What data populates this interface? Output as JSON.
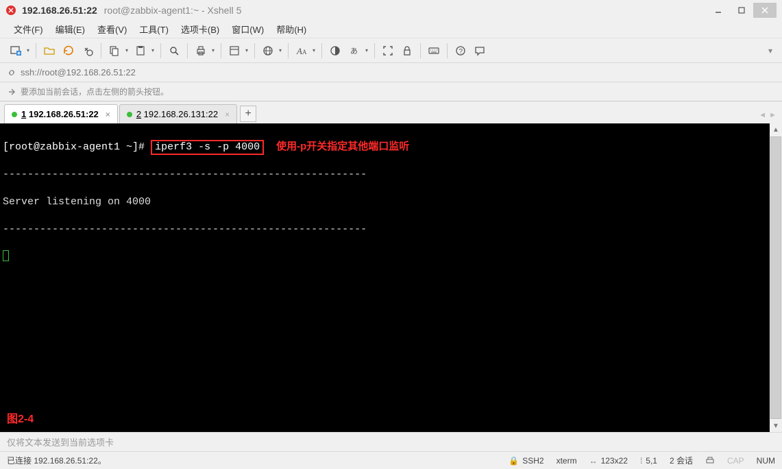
{
  "window": {
    "title_active": "192.168.26.51:22",
    "title_rest": "root@zabbix-agent1:~ - Xshell 5"
  },
  "menu": {
    "file": "文件(F)",
    "edit": "编辑(E)",
    "view": "查看(V)",
    "tools": "工具(T)",
    "tabs": "选项卡(B)",
    "window": "窗口(W)",
    "help": "帮助(H)"
  },
  "address": {
    "url": "ssh://root@192.168.26.51:22"
  },
  "hint": {
    "text": "要添加当前会话，点击左侧的箭头按钮。"
  },
  "tabs": {
    "items": [
      {
        "num": "1",
        "label": "192.168.26.51:22",
        "active": true
      },
      {
        "num": "2",
        "label": "192.168.26.131:22",
        "active": false
      }
    ]
  },
  "terminal": {
    "prompt": "[root@zabbix-agent1 ~]#",
    "command": "iperf3 -s -p 4000",
    "annotation": "使用-p开关指定其他端口监听",
    "dashes": "-----------------------------------------------------------",
    "listen_line": "Server listening on 4000",
    "figure_label": "图2-4"
  },
  "inputbar": {
    "placeholder": "仅将文本发送到当前选项卡"
  },
  "status": {
    "connected": "已连接 192.168.26.51:22。",
    "proto": "SSH2",
    "term": "xterm",
    "size": "123x22",
    "cursor": "5,1",
    "sessions": "2 会话",
    "cap": "CAP",
    "num": "NUM"
  }
}
